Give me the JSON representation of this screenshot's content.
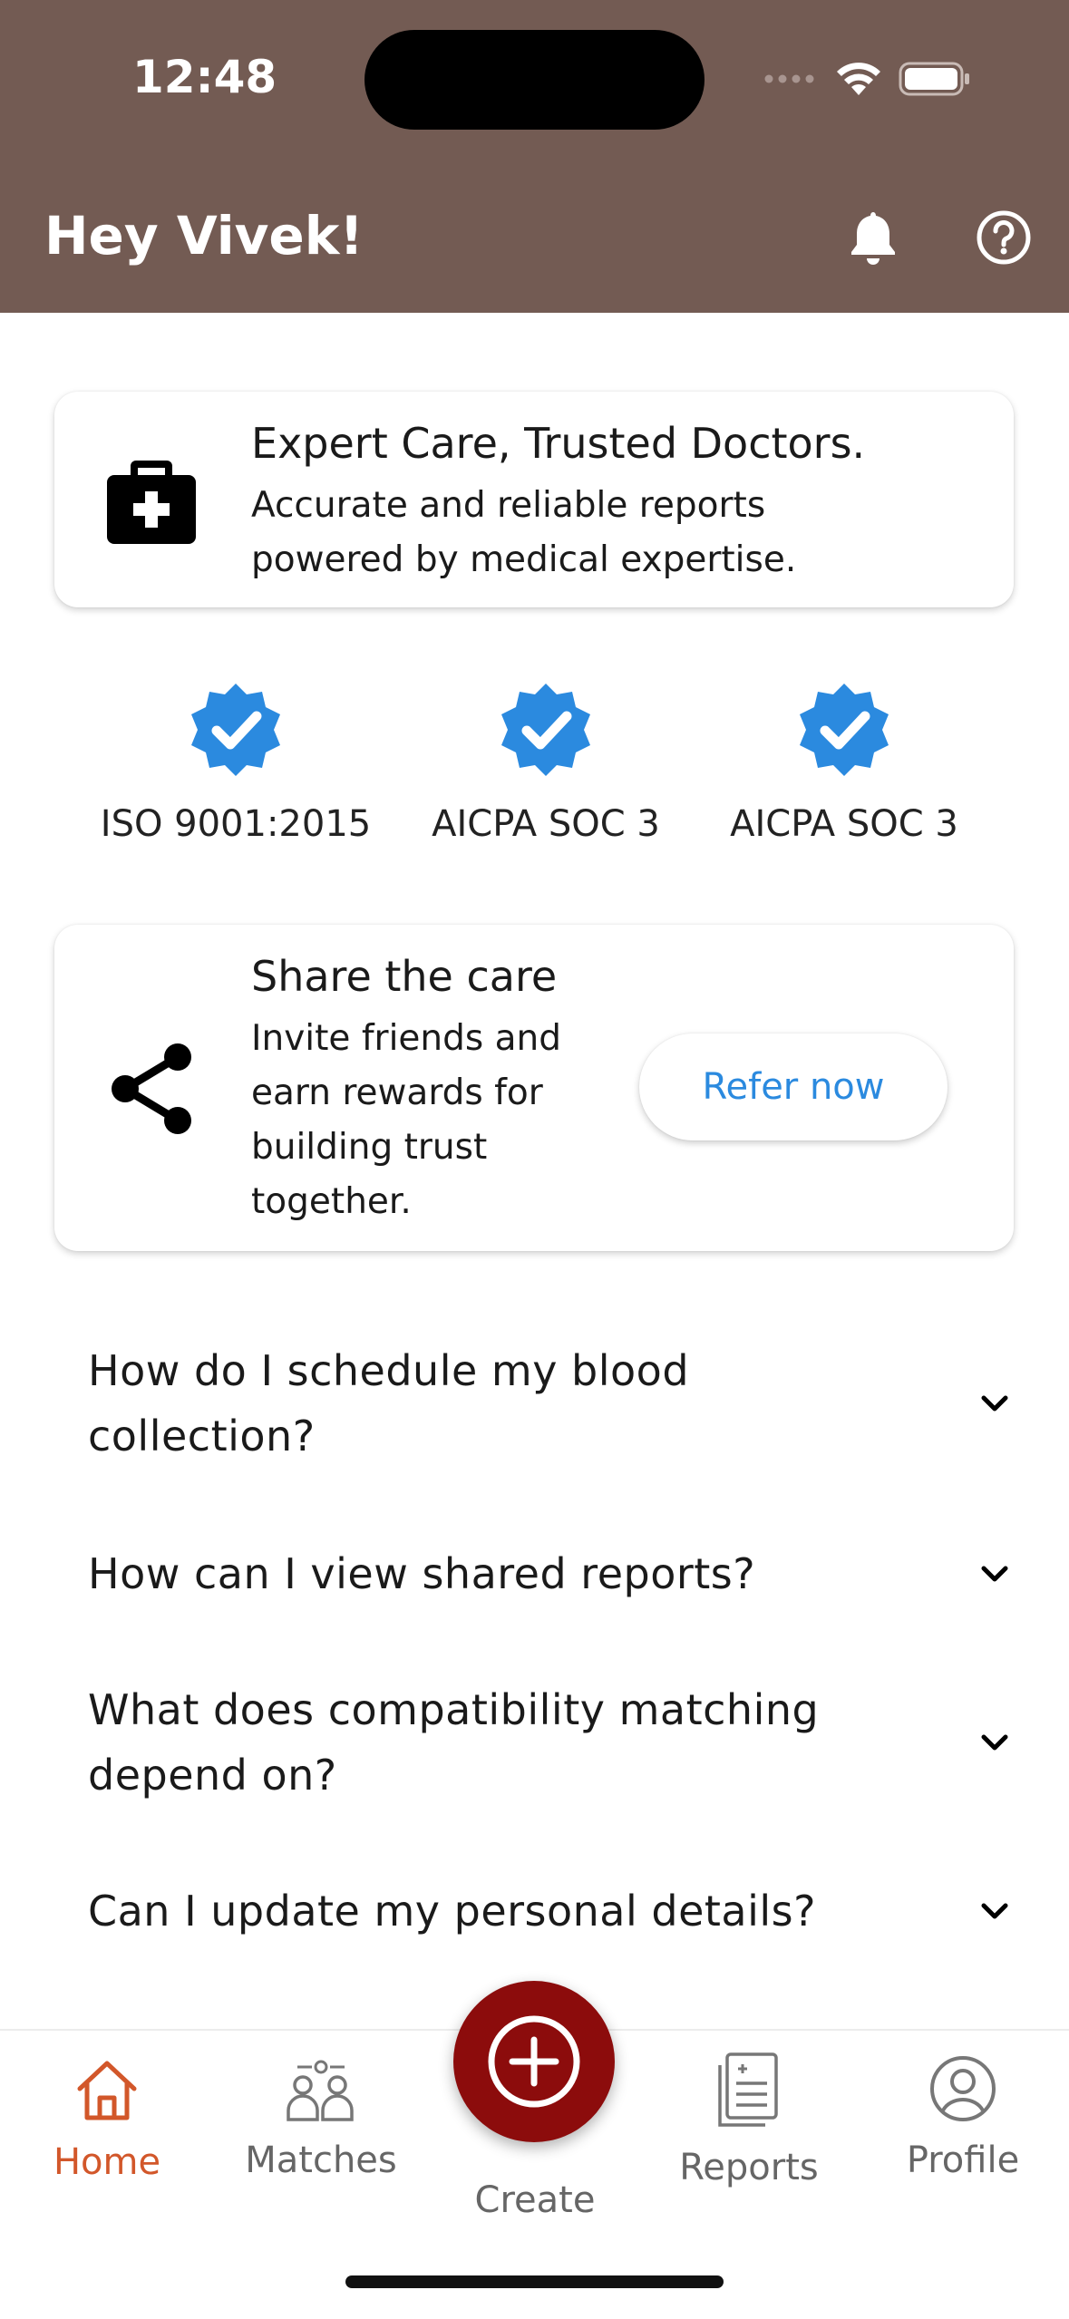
{
  "status": {
    "time": "12:48"
  },
  "header": {
    "greeting": "Hey Vivek!"
  },
  "expert_card": {
    "title": "Expert Care, Trusted Doctors.",
    "line1": "Accurate and reliable reports",
    "line2": "powered by medical expertise."
  },
  "certifications": [
    {
      "label": "ISO 9001:2015"
    },
    {
      "label": "AICPA SOC 3"
    },
    {
      "label": "AICPA SOC 3"
    }
  ],
  "share_card": {
    "title": "Share the care",
    "line1": "Invite friends and",
    "line2": "earn rewards for",
    "line3": "building trust",
    "line4": "together.",
    "button_label": "Refer now"
  },
  "faqs": [
    {
      "line1": "How do I schedule my blood",
      "line2": "collection?"
    },
    {
      "line1": "How can I view shared reports?"
    },
    {
      "line1": "What does compatibility matching",
      "line2": "depend on?"
    },
    {
      "line1": "Can I update my personal details?"
    }
  ],
  "nav": {
    "home": "Home",
    "matches": "Matches",
    "create": "Create",
    "reports": "Reports",
    "profile": "Profile"
  },
  "icons": {
    "header": [
      "bell-icon",
      "help-icon"
    ],
    "expert": "medical-kit-icon",
    "cert": "verified-badge-icon",
    "share": "share-icon",
    "faq": "chevron-down-icon"
  },
  "colors": {
    "header_bg": "#735b53",
    "verified_blue": "#2b8adf",
    "active_tab": "#d2572a",
    "create_button": "#8c0c0c"
  }
}
